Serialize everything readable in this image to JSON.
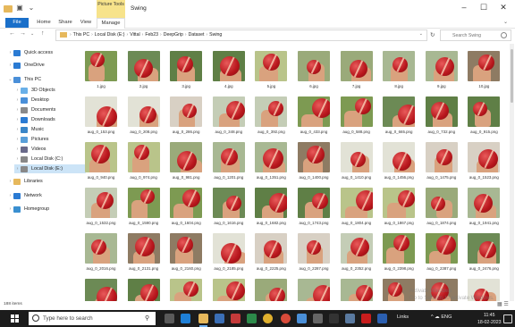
{
  "window": {
    "title": "Swing",
    "contextual_tab_group": "Picture Tools",
    "controls": {
      "minimize": "–",
      "maximize": "☐",
      "close": "✕"
    }
  },
  "ribbon": {
    "tabs": [
      "File",
      "Home",
      "Share",
      "View",
      "Manage"
    ],
    "expand": "⌄"
  },
  "address_bar": {
    "nav": {
      "back": "←",
      "forward": "→",
      "recent": "⌄",
      "up": "↑"
    },
    "crumbs": [
      "This PC",
      "Local Disk (E:)",
      "Vittal",
      "Feb23",
      "DeepGrip",
      "Dataset",
      "Swing"
    ],
    "search_placeholder": "Search Swing"
  },
  "nav_pane": {
    "items": [
      {
        "label": "Quick access",
        "icon": "star-icon",
        "color": "#2b7bd3"
      },
      {
        "label": "OneDrive",
        "icon": "cloud-icon",
        "color": "#2b7bd3"
      },
      {
        "label": "This PC",
        "icon": "computer-icon",
        "color": "#4a8fd8"
      },
      {
        "label": "3D Objects",
        "icon": "cube-icon",
        "color": "#6ab0e8"
      },
      {
        "label": "Desktop",
        "icon": "desktop-icon",
        "color": "#4a8fd8"
      },
      {
        "label": "Documents",
        "icon": "documents-icon",
        "color": "#8a8a8a"
      },
      {
        "label": "Downloads",
        "icon": "download-icon",
        "color": "#2b7bd3"
      },
      {
        "label": "Music",
        "icon": "music-icon",
        "color": "#3a86c8"
      },
      {
        "label": "Pictures",
        "icon": "pictures-icon",
        "color": "#5a9fd9"
      },
      {
        "label": "Videos",
        "icon": "videos-icon",
        "color": "#6a6a8a"
      },
      {
        "label": "Local Disk (C:)",
        "icon": "drive-icon",
        "color": "#888888"
      },
      {
        "label": "Local Disk (E:)",
        "icon": "drive-icon",
        "color": "#888888"
      },
      {
        "label": "Libraries",
        "icon": "libraries-icon",
        "color": "#e6b85c"
      },
      {
        "label": "Network",
        "icon": "network-icon",
        "color": "#2b7bd3"
      },
      {
        "label": "Homegroup",
        "icon": "homegroup-icon",
        "color": "#3a8fd0"
      }
    ]
  },
  "files": {
    "rows": [
      [
        "1.jpg",
        "2.jpg",
        "3.jpg",
        "4.jpg",
        "5.jpg",
        "6.jpg",
        "7.jpg",
        "8.jpg",
        "9.jpg",
        "10.jpg"
      ],
      [
        "aug_0_153.png",
        "aug_0_208.png",
        "aug_0_286.png",
        "aug_0_348.png",
        "aug_0_392.png",
        "aug_0_433.png",
        "aug_0_588.png",
        "aug_0_665.png",
        "aug_0_732.png",
        "aug_0_915.png"
      ],
      [
        "aug_0_940.png",
        "aug_0_974.png",
        "aug_0_981.png",
        "aug_0_1201.png",
        "aug_0_1351.png",
        "aug_0_1400.png",
        "aug_0_1410.png",
        "aug_0_1456.png",
        "aug_0_1475.png",
        "aug_0_1523.png"
      ],
      [
        "aug_0_1532.png",
        "aug_0_1590.png",
        "aug_0_1604.png",
        "aug_0_1616.png",
        "aug_0_1682.png",
        "aug_0_1743.png",
        "aug_0_1804.png",
        "aug_0_1867.png",
        "aug_0_1874.png",
        "aug_0_1941.png"
      ],
      [
        "aug_0_2016.png",
        "aug_0_2131.png",
        "aug_0_2160.png",
        "aug_0_2185.png",
        "aug_0_2225.png",
        "aug_0_2287.png",
        "aug_0_2352.png",
        "aug_0_2398.png",
        "aug_0_2387.png",
        "aug_0_2476.png"
      ],
      [
        "",
        "",
        "",
        "",
        "",
        "",
        "",
        "",
        "",
        ""
      ]
    ]
  },
  "status": {
    "count": "188 items"
  },
  "watermark": {
    "line1": "Activate Windows",
    "line2": "Go to Settings to activate Windows."
  },
  "taskbar": {
    "search_placeholder": "Type here to search",
    "tray_label": "Links",
    "tray_icons": "^ ☁ ENG",
    "time": "11:45",
    "date": "18-02-2023"
  },
  "colors": {
    "accent": "#1a6fc9",
    "selected": "#cce4f7",
    "picture_tools": "#f7e38b",
    "taskbar": "#1c1c1c"
  }
}
